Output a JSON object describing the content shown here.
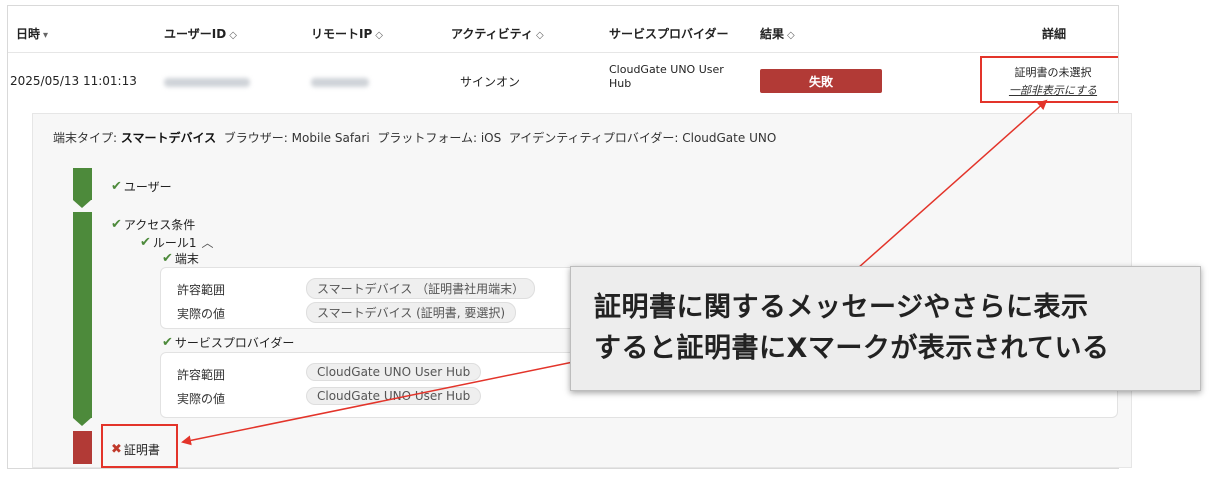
{
  "table": {
    "columns": [
      {
        "label": "日時",
        "sort": "▾"
      },
      {
        "label": "ユーザーID",
        "sort": "◇"
      },
      {
        "label": "リモートIP",
        "sort": "◇"
      },
      {
        "label": "アクティビティ",
        "sort": "◇"
      },
      {
        "label": "サービスプロバイダー",
        "sort": ""
      },
      {
        "label": "結果",
        "sort": "◇"
      },
      {
        "label": "詳細",
        "sort": ""
      }
    ],
    "row": {
      "datetime": "2025/05/13 11:01:13",
      "activity": "サインオン",
      "service_provider_line1": "CloudGate UNO User",
      "service_provider_line2": "Hub",
      "result": "失敗",
      "detail_line1": "証明書の未選択",
      "detail_link": "一部非表示にする"
    }
  },
  "detail": {
    "device_type_label": "端末タイプ:",
    "device_type_value": "スマートデバイス",
    "browser_label": "ブラウザー:",
    "browser_value": "Mobile Safari",
    "platform_label": "プラットフォーム:",
    "platform_value": "iOS",
    "idp_label": "アイデンティティプロバイダー:",
    "idp_value": "CloudGate UNO",
    "steps": {
      "user": "ユーザー",
      "access": "アクセス条件",
      "rule": "ルール1",
      "rule_toggle": "︿",
      "device": "端末",
      "sp": "サービスプロバイダー",
      "cert": "証明書"
    },
    "device_card": {
      "allowed_label": "許容範囲",
      "allowed_value": "スマートデバイス （証明書社用端末）",
      "actual_label": "実際の値",
      "actual_value": "スマートデバイス (証明書, 要選択)"
    },
    "sp_card": {
      "allowed_label": "許容範囲",
      "allowed_value": "CloudGate UNO User Hub",
      "actual_label": "実際の値",
      "actual_value": "CloudGate UNO User Hub"
    }
  },
  "callout": {
    "line1": "証明書に関するメッセージやさらに表示",
    "line2": "すると証明書にXマークが表示されている"
  },
  "colors": {
    "fail": "#b23a36",
    "success": "#4d8a3b",
    "annotation": "#e3342a"
  },
  "icons": {
    "check": "✔",
    "cross": "✖"
  }
}
